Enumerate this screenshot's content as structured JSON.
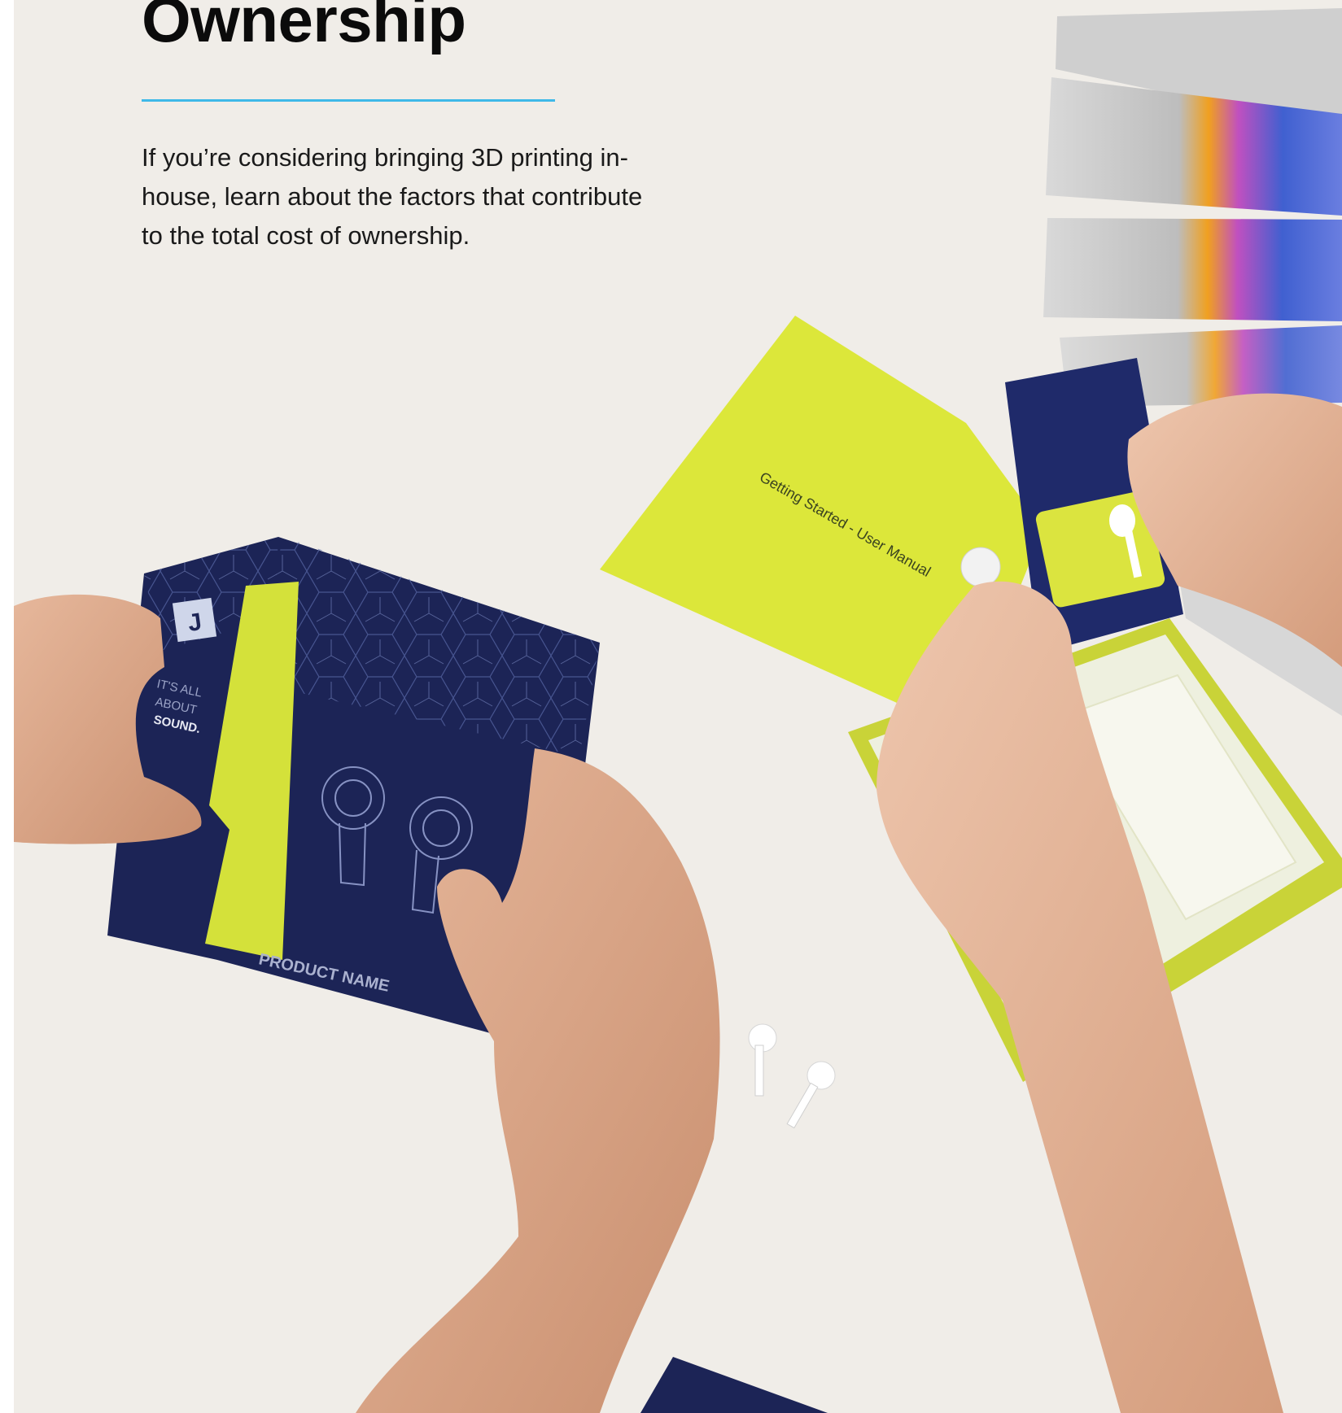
{
  "hero": {
    "title": "Ownership",
    "accent_color": "#3fb9e8",
    "intro": "If you’re considering bringing 3D printing in-house, learn about the factors that contribute to the total cost of ownership."
  },
  "photo": {
    "box_monogram": "J",
    "box_tagline": [
      "IT'S ALL",
      "ABOUT",
      "SOUND."
    ],
    "box_product_name": "PRODUCT NAME",
    "manual_title": "Getting Started - User Manual",
    "colors": {
      "navy": "#1c2456",
      "lime": "#dde838",
      "background": "#f0ede8"
    }
  }
}
